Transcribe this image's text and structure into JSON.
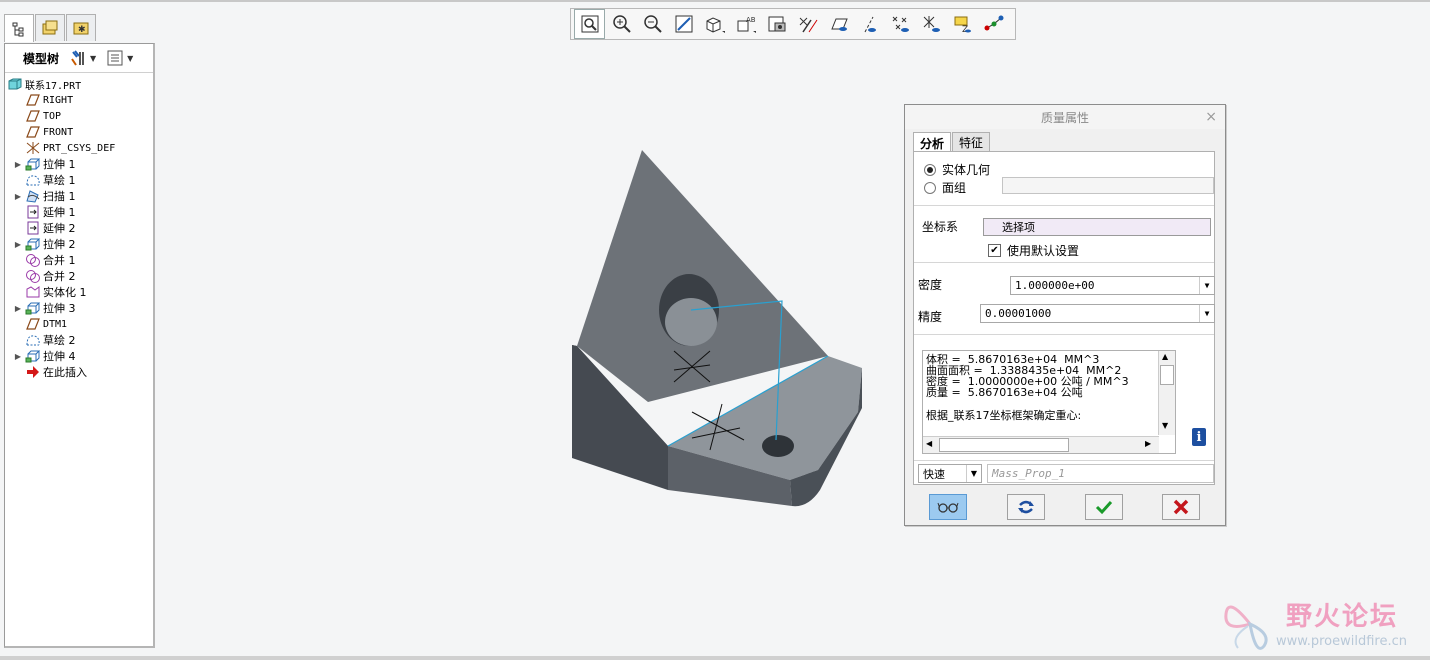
{
  "model_tree": {
    "title": "模型树",
    "items": [
      {
        "label": "联系17.PRT",
        "expand": false,
        "icon": "part-icon",
        "indent": 0,
        "mono": true
      },
      {
        "label": "RIGHT",
        "expand": false,
        "icon": "datum-plane-icon",
        "indent": 1,
        "mono": true
      },
      {
        "label": "TOP",
        "expand": false,
        "icon": "datum-plane-icon",
        "indent": 1,
        "mono": true
      },
      {
        "label": "FRONT",
        "expand": false,
        "icon": "datum-plane-icon",
        "indent": 1,
        "mono": true
      },
      {
        "label": "PRT_CSYS_DEF",
        "expand": false,
        "icon": "csys-icon",
        "indent": 1,
        "mono": true
      },
      {
        "label": "拉伸 1",
        "expand": true,
        "icon": "extrude-icon",
        "indent": 1
      },
      {
        "label": "草绘 1",
        "expand": false,
        "icon": "sketch-icon",
        "indent": 1
      },
      {
        "label": "扫描 1",
        "expand": true,
        "icon": "sweep-icon",
        "indent": 1
      },
      {
        "label": "延伸 1",
        "expand": false,
        "icon": "extend-icon",
        "indent": 1
      },
      {
        "label": "延伸 2",
        "expand": false,
        "icon": "extend-icon",
        "indent": 1
      },
      {
        "label": "拉伸 2",
        "expand": true,
        "icon": "extrude-icon",
        "indent": 1
      },
      {
        "label": "合并 1",
        "expand": false,
        "icon": "merge-icon",
        "indent": 1
      },
      {
        "label": "合并 2",
        "expand": false,
        "icon": "merge-icon",
        "indent": 1
      },
      {
        "label": "实体化 1",
        "expand": false,
        "icon": "solidify-icon",
        "indent": 1
      },
      {
        "label": "拉伸 3",
        "expand": true,
        "icon": "extrude-icon",
        "indent": 1
      },
      {
        "label": "DTM1",
        "expand": false,
        "icon": "datum-plane-icon",
        "indent": 1,
        "mono": true
      },
      {
        "label": "草绘 2",
        "expand": false,
        "icon": "sketch-icon",
        "indent": 1
      },
      {
        "label": "拉伸 4",
        "expand": true,
        "icon": "extrude-icon",
        "indent": 1
      },
      {
        "label": "在此插入",
        "expand": false,
        "icon": "insert-here-icon",
        "indent": 1
      }
    ]
  },
  "dialog": {
    "title": "质量属性",
    "tabs": [
      "分析",
      "特征"
    ],
    "radio_solid": "实体几何",
    "radio_quilt": "面组",
    "csys_label": "坐标系",
    "csys_value": "选择项",
    "default_checkbox": "使用默认设置",
    "density_label": "密度",
    "density_value": "1.000000e+00",
    "precision_label": "精度",
    "precision_value": "0.00001000",
    "results": [
      "体积 =  5.8670163e+04  MM^3",
      "曲面面积 =  1.3388435e+04  MM^2",
      "密度 =  1.0000000e+00 公吨 / MM^3",
      "质量 =  5.8670163e+04 公吨",
      "",
      "根据_联系17坐标框架确定重心:"
    ],
    "mode_value": "快速",
    "name_placeholder": "Mass_Prop_1"
  },
  "watermark": {
    "title": "野火论坛",
    "url": "www.proewildfire.cn"
  }
}
